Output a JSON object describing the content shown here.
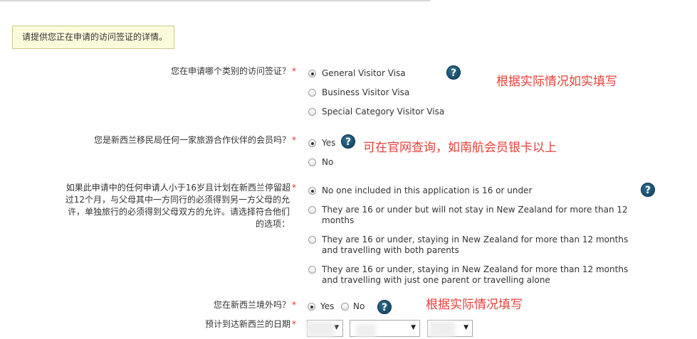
{
  "notice": "请提供您正在申请的访问签证的详情。",
  "required_mark": "*",
  "help_glyph": "?",
  "q1": {
    "label": "您在申请哪个类别的访问签证？",
    "options": [
      "General Visitor Visa",
      "Business Visitor Visa",
      "Special Category Visitor Visa"
    ],
    "selected": "General Visitor Visa",
    "note": "根据实际情况如实填写"
  },
  "q2": {
    "label": "您是新西兰移民局任何一家旅游合作伙伴的会员吗？",
    "options": [
      "Yes",
      "No"
    ],
    "selected": "Yes",
    "note": "可在官网查询，如南航会员银卡以上"
  },
  "q3": {
    "label_lines": [
      "如果此申请中的任何申请人小于16岁且计划在新西兰停留超",
      "过12个月，与父母其中一方同行的必须得到另一方父母的允",
      "许，单独旅行的必须得到父母双方的允许。请选择符合他们",
      "的选项："
    ],
    "options": [
      {
        "line1": "No one included in this application is 16 or under",
        "line2": ""
      },
      {
        "line1": "They are 16 or under but will not stay in New Zealand for more than 12",
        "line2": "months"
      },
      {
        "line1": "They are 16 or under, staying in New Zealand for more than 12 months",
        "line2": "and travelling with both parents"
      },
      {
        "line1": "They are 16 or under, staying in New Zealand for more than 12 months",
        "line2": "and travelling with just one parent or travelling alone"
      }
    ],
    "selected_index": 0
  },
  "q4": {
    "label": "您在新西兰境外吗？",
    "options": [
      "Yes",
      "No"
    ],
    "selected": "Yes",
    "note": "根据实际情况填写"
  },
  "q5": {
    "label": "预计到达新西兰的日期"
  },
  "colors": {
    "required": "#e0301e",
    "annotation": "#e8403a",
    "help_icon": "#0c3f5c",
    "notice_bg": "#fbfbdc"
  }
}
